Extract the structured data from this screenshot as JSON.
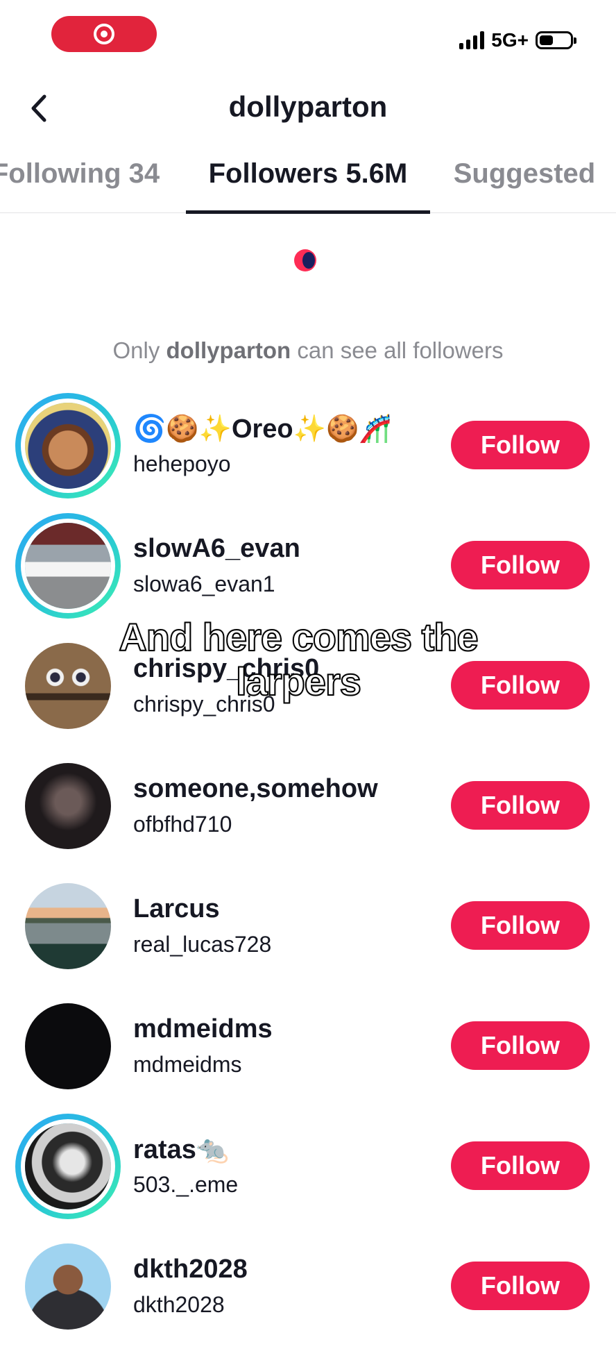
{
  "status_bar": {
    "network": "5G+",
    "battery_level": 0.45
  },
  "header": {
    "title": "dollyparton"
  },
  "tabs": [
    {
      "label": "Following 34",
      "active": false
    },
    {
      "label": "Followers 5.6M",
      "active": true
    },
    {
      "label": "Suggested",
      "active": false
    }
  ],
  "notice": {
    "prefix": "Only ",
    "user": "dollyparton",
    "suffix": " can see all followers"
  },
  "followers": [
    {
      "display_name": "🌀🍪✨Oreo✨🍪🎢",
      "username": "hehepoyo",
      "button": "Follow",
      "story_ring": true
    },
    {
      "display_name": "slowA6_evan",
      "username": "slowa6_evan1",
      "button": "Follow",
      "story_ring": true
    },
    {
      "display_name": "chrispy_chris0",
      "username": "chrispy_chris0",
      "button": "Follow",
      "story_ring": false
    },
    {
      "display_name": "someone,somehow",
      "username": "ofbfhd710",
      "button": "Follow",
      "story_ring": false
    },
    {
      "display_name": "Larcus",
      "username": "real_lucas728",
      "button": "Follow",
      "story_ring": false
    },
    {
      "display_name": "mdmeidms",
      "username": "mdmeidms",
      "button": "Follow",
      "story_ring": false
    },
    {
      "display_name": "ratas🐀",
      "username": "503._.eme",
      "button": "Follow",
      "story_ring": true
    },
    {
      "display_name": "dkth2028",
      "username": "dkth2028",
      "button": "Follow",
      "story_ring": false
    }
  ],
  "caption": "And here comes the larpers",
  "colors": {
    "follow_button": "#ee1d52",
    "record_pill": "#e1243c",
    "story_ring_start": "#2da8f4",
    "story_ring_end": "#3cf0b0"
  }
}
